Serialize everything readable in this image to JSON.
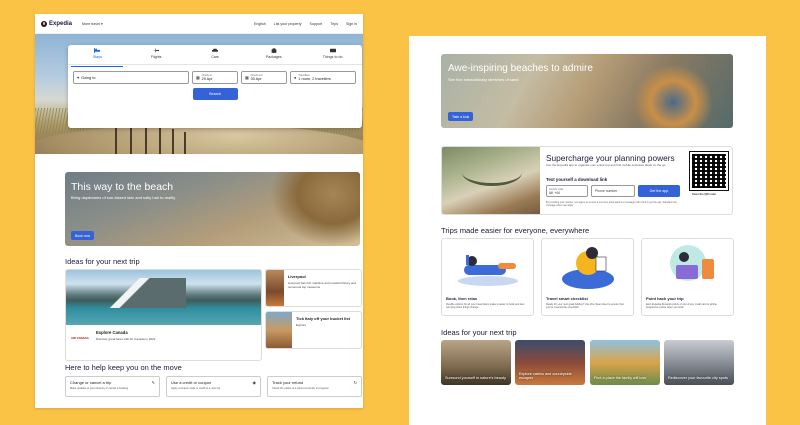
{
  "left": {
    "logo": "Expedia",
    "more_travel": "More travel",
    "nav": [
      "English",
      "List your property",
      "Support",
      "Trips",
      "Sign in"
    ],
    "tabs": [
      {
        "label": "Stays",
        "icon": "bed-icon"
      },
      {
        "label": "Flights",
        "icon": "plane-icon"
      },
      {
        "label": "Cars",
        "icon": "car-icon"
      },
      {
        "label": "Packages",
        "icon": "suitcase-icon"
      },
      {
        "label": "Things to do",
        "icon": "ticket-icon"
      }
    ],
    "going_to_placeholder": "Going to",
    "check_in": {
      "label": "Check-in",
      "value": "29 Apr"
    },
    "check_out": {
      "label": "Check-out",
      "value": "30 Apr"
    },
    "travellers": {
      "label": "Travellers",
      "value": "1 room, 2 travellers"
    },
    "search_label": "Search",
    "promo": {
      "title": "This way to the beach",
      "subtitle": "Bring daydreams of sun-kissed skin and salty hair to reality",
      "button": "Book now"
    },
    "ideas_title": "Ideas for your next trip",
    "ideas_big": {
      "brand": "AIR CANADA",
      "title": "Explore Canada",
      "desc": "Discover great fares with Air Canada in 2022"
    },
    "small_cards": [
      {
        "title": "Liverpool",
        "desc": "Liverpool has rich maritime and musical history and numerous top museums"
      },
      {
        "title": "Tick Italy off your bucket list",
        "desc": "Explore"
      }
    ],
    "help_title": "Here to help keep you on the move",
    "help_cards": [
      {
        "title": "Change or cancel a trip",
        "sub": "Make updates to your itinerary or cancel a booking"
      },
      {
        "title": "Use a credit or coupon",
        "sub": "Apply a coupon code or credit to a new trip"
      },
      {
        "title": "Track your refund",
        "sub": "Check the status of a refund currently in progress"
      }
    ]
  },
  "right": {
    "hero": {
      "title": "Awe-inspiring beaches to admire",
      "subtitle": "See five extraordinary stretches of sand",
      "button": "Take a look"
    },
    "app": {
      "title": "Supercharge your planning powers",
      "subtitle": "Use the Expedia app to organise your entire trip and find mobile-exclusive deals on the go",
      "link_title": "Text yourself a download link",
      "country_label": "Country code",
      "country_value": "UK +44",
      "phone_placeholder": "Phone number",
      "button": "Get the app",
      "legal": "By providing your number, you agree to receive a one-time automated text message with a link to get the app. Standard text message rates may apply.",
      "qr_label": "Scan the QR code"
    },
    "trips_title": "Trips made easier for everyone, everywhere",
    "features": [
      {
        "title": "Book, then relax",
        "desc": "Flexible options for all your travel plans make it easier to book and less worrying when things change"
      },
      {
        "title": "Travel smart checklist",
        "desc": "Ready for your next great holiday? Use this cheat sheet to ensure that you've covered the essentials"
      },
      {
        "title": "Point hack your trip",
        "desc": "Earn Expedia Rewards points on top of any credit card or airline programme points when you book"
      }
    ],
    "ideas_title": "Ideas for your next trip",
    "ideas": [
      "Surround yourself in nature's beauty",
      "Explore cabins and countryside escapes",
      "Find a place the family will love",
      "Rediscover your favourite city spots"
    ]
  },
  "colors": {
    "background": "#FBC345",
    "primary_button": "#3662d8",
    "active_tab": "#1668e3",
    "heading": "#1b1b3a"
  }
}
